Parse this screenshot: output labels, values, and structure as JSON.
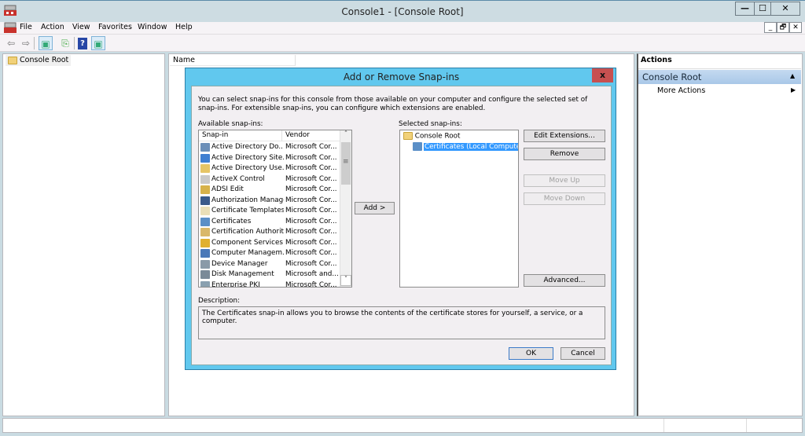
{
  "window": {
    "title": "Console1 - [Console Root]",
    "controls": {
      "minimize": "—",
      "maximize": "☐",
      "close": "✕"
    },
    "mdi_controls": {
      "minimize": "_",
      "restore": "🗗",
      "close": "✕"
    }
  },
  "menubar": [
    "File",
    "Action",
    "View",
    "Favorites",
    "Window",
    "Help"
  ],
  "toolbar": {
    "back": "⇦",
    "forward": "⇨",
    "show_hide_tree": "▣",
    "export": "⎘",
    "help": "?",
    "show_hide_action": "▣"
  },
  "tree": {
    "root": "Console Root"
  },
  "center": {
    "column_name": "Name"
  },
  "actions": {
    "header": "Actions",
    "section": "Console Root",
    "collapse": "▲",
    "items": [
      {
        "label": "More Actions",
        "arrow": "▶"
      }
    ]
  },
  "dialog": {
    "title": "Add or Remove Snap-ins",
    "close": "x",
    "intro": "You can select snap-ins for this console from those available on your computer and configure the selected set of snap-ins. For extensible snap-ins, you can configure which extensions are enabled.",
    "available_label": "Available snap-ins:",
    "columns": {
      "snapin": "Snap-in",
      "vendor": "Vendor"
    },
    "available": [
      {
        "name": "Active Directory Do...",
        "vendor": "Microsoft Cor...",
        "icon": "ad-domains-icon",
        "color": "#6b8fb8"
      },
      {
        "name": "Active Directory Site...",
        "vendor": "Microsoft Cor...",
        "icon": "ad-sites-icon",
        "color": "#3f7fd1"
      },
      {
        "name": "Active Directory Use...",
        "vendor": "Microsoft Cor...",
        "icon": "ad-users-icon",
        "color": "#e6c566"
      },
      {
        "name": "ActiveX Control",
        "vendor": "Microsoft Cor...",
        "icon": "activex-icon",
        "color": "#c9c9c9"
      },
      {
        "name": "ADSI Edit",
        "vendor": "Microsoft Cor...",
        "icon": "adsi-edit-icon",
        "color": "#d7b24a"
      },
      {
        "name": "Authorization Manager",
        "vendor": "Microsoft Cor...",
        "icon": "authorization-icon",
        "color": "#3a5a8a"
      },
      {
        "name": "Certificate Templates",
        "vendor": "Microsoft Cor...",
        "icon": "cert-templates-icon",
        "color": "#e9dfb8"
      },
      {
        "name": "Certificates",
        "vendor": "Microsoft Cor...",
        "icon": "certificates-icon",
        "color": "#5a8fc7"
      },
      {
        "name": "Certification Authority",
        "vendor": "Microsoft Cor...",
        "icon": "cert-authority-icon",
        "color": "#d9b86a"
      },
      {
        "name": "Component Services",
        "vendor": "Microsoft Cor...",
        "icon": "component-services-icon",
        "color": "#e0b030"
      },
      {
        "name": "Computer Managem...",
        "vendor": "Microsoft Cor...",
        "icon": "computer-mgmt-icon",
        "color": "#4a78b8"
      },
      {
        "name": "Device Manager",
        "vendor": "Microsoft Cor...",
        "icon": "device-manager-icon",
        "color": "#8a9aa8"
      },
      {
        "name": "Disk Management",
        "vendor": "Microsoft and...",
        "icon": "disk-mgmt-icon",
        "color": "#7a8a98"
      },
      {
        "name": "Enterprise PKI",
        "vendor": "Microsoft Cor...",
        "icon": "enterprise-pki-icon",
        "color": "#8aa0b0"
      }
    ],
    "scroll": {
      "up": "˄",
      "down": "˅",
      "grip": "≡"
    },
    "add_button": "Add >",
    "selected_label": "Selected snap-ins:",
    "selected": [
      {
        "name": "Console Root",
        "level": 0
      },
      {
        "name": "Certificates (Local Computer)",
        "level": 1,
        "selected": true
      }
    ],
    "buttons": {
      "edit_extensions": "Edit Extensions...",
      "remove": "Remove",
      "move_up": "Move Up",
      "move_down": "Move Down",
      "advanced": "Advanced...",
      "ok": "OK",
      "cancel": "Cancel"
    },
    "description_label": "Description:",
    "description": "The Certificates snap-in allows you to browse the contents of the certificate stores for yourself, a service, or a computer."
  }
}
